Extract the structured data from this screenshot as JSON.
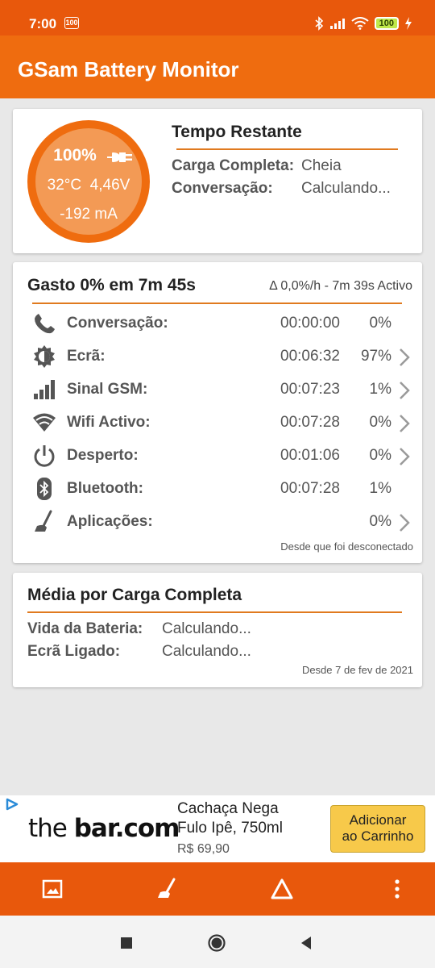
{
  "status_bar": {
    "time": "7:00",
    "notification_badge": "100",
    "battery_level": "100"
  },
  "app": {
    "title": "GSam Battery Monitor",
    "accent_color": "#ef6c0f",
    "status_color": "#e8580c"
  },
  "battery_gauge": {
    "percent": "100%",
    "temperature": "32°C",
    "voltage": "4,46V",
    "current": "-192 mA",
    "icon": "plug-icon"
  },
  "time_remaining": {
    "title": "Tempo Restante",
    "rows": [
      {
        "label": "Carga Completa:",
        "value": "Cheia"
      },
      {
        "label": "Conversação:",
        "value": "Calculando..."
      }
    ]
  },
  "usage": {
    "title": "Gasto 0% em 7m 45s",
    "rate": "Δ 0,0%/h - 7m 39s Activo",
    "footer": "Desde que foi desconectado",
    "rows": [
      {
        "icon": "phone-icon",
        "label": "Conversação:",
        "time": "00:00:00",
        "percent": "0%",
        "chevron": false
      },
      {
        "icon": "brightness-icon",
        "label": "Ecrã:",
        "time": "00:06:32",
        "percent": "97%",
        "chevron": true
      },
      {
        "icon": "signal-icon",
        "label": "Sinal GSM:",
        "time": "00:07:23",
        "percent": "1%",
        "chevron": true
      },
      {
        "icon": "wifi-icon",
        "label": "Wifi Activo:",
        "time": "00:07:28",
        "percent": "0%",
        "chevron": true
      },
      {
        "icon": "power-icon",
        "label": "Desperto:",
        "time": "00:01:06",
        "percent": "0%",
        "chevron": true
      },
      {
        "icon": "bluetooth-icon",
        "label": "Bluetooth:",
        "time": "00:07:28",
        "percent": "1%",
        "chevron": false
      },
      {
        "icon": "broom-icon",
        "label": "Aplicações:",
        "time": "",
        "percent": "0%",
        "chevron": true
      }
    ]
  },
  "average": {
    "title": "Média por Carga Completa",
    "rows": [
      {
        "label": "Vida da Bateria:",
        "value": "Calculando..."
      },
      {
        "label": "Ecrã Ligado:",
        "value": "Calculando..."
      }
    ],
    "footer": "Desde 7 de fev de 2021"
  },
  "ad": {
    "logo_prefix": "the ",
    "logo_main": "bar.com",
    "product_line1": "Cachaça Nega",
    "product_line2": "Fulo Ipê, 750ml",
    "price": "R$ 69,90",
    "cta_line1": "Adicionar",
    "cta_line2": "ao Carrinho"
  },
  "bottom_nav": [
    "image-icon",
    "broom-icon",
    "delta-icon",
    "more-vert-icon"
  ],
  "system_nav": [
    "recents-icon",
    "home-icon",
    "back-icon"
  ]
}
